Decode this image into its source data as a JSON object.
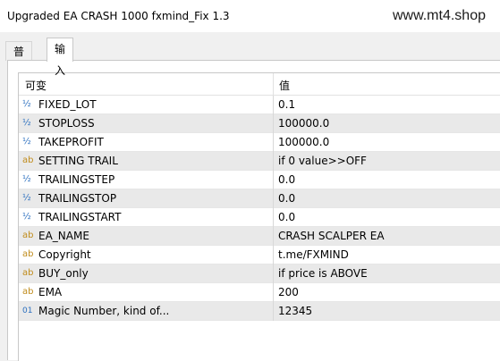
{
  "window": {
    "title": "Upgraded EA CRASH 1000 fxmind_Fix 1.3"
  },
  "watermark": "www.mt4.shop",
  "tabs": [
    {
      "label": "普通",
      "active": false
    },
    {
      "label": "输入",
      "active": true
    }
  ],
  "table": {
    "headers": {
      "variable": "可变",
      "value": "值"
    },
    "rows": [
      {
        "icon": "½",
        "icon_name": "double-type-icon",
        "name": "FIXED_LOT",
        "value": "0.1"
      },
      {
        "icon": "½",
        "icon_name": "double-type-icon",
        "name": "STOPLOSS",
        "value": "100000.0"
      },
      {
        "icon": "½",
        "icon_name": "double-type-icon",
        "name": "TAKEPROFIT",
        "value": "100000.0"
      },
      {
        "icon": "ab",
        "icon_name": "string-type-icon",
        "name": "SETTING TRAIL",
        "value": "if 0 value>>OFF"
      },
      {
        "icon": "½",
        "icon_name": "double-type-icon",
        "name": "TRAILINGSTEP",
        "value": "0.0"
      },
      {
        "icon": "½",
        "icon_name": "double-type-icon",
        "name": "TRAILINGSTOP",
        "value": "0.0"
      },
      {
        "icon": "½",
        "icon_name": "double-type-icon",
        "name": "TRAILINGSTART",
        "value": "0.0"
      },
      {
        "icon": "ab",
        "icon_name": "string-type-icon",
        "name": "EA_NAME",
        "value": "CRASH SCALPER EA"
      },
      {
        "icon": "ab",
        "icon_name": "string-type-icon",
        "name": "Copyright",
        "value": "t.me/FXMIND"
      },
      {
        "icon": "ab",
        "icon_name": "string-type-icon",
        "name": "BUY_only",
        "value": "if price is ABOVE"
      },
      {
        "icon": "ab",
        "icon_name": "string-type-icon",
        "name": "EMA",
        "value": "200"
      },
      {
        "icon": "01",
        "icon_name": "integer-type-icon",
        "name": "Magic Number, kind of...",
        "value": "12345"
      }
    ]
  },
  "colors": {
    "alt_row": "#e9e9e9",
    "double_icon": "#2b6fbf",
    "string_icon": "#c08c1c"
  }
}
